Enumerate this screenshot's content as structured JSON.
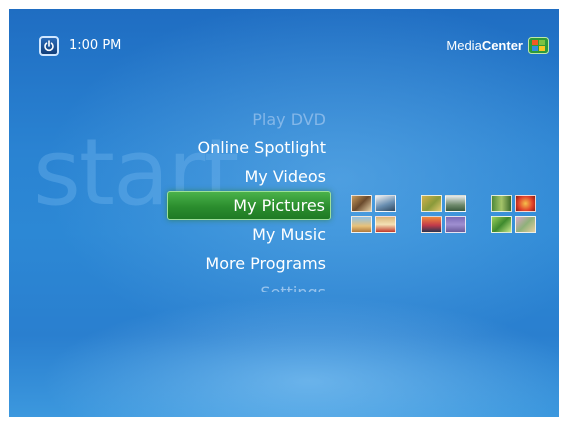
{
  "header": {
    "clock": "1:00 PM",
    "brand_light": "Media",
    "brand_bold": "Center"
  },
  "watermark": "start",
  "menu": {
    "items": [
      {
        "label": "Play DVD",
        "state": "faded-top"
      },
      {
        "label": "Online Spotlight",
        "state": "normal"
      },
      {
        "label": "My Videos",
        "state": "normal"
      },
      {
        "label": "My Pictures",
        "state": "selected"
      },
      {
        "label": "My Music",
        "state": "normal"
      },
      {
        "label": "More Programs",
        "state": "normal"
      },
      {
        "label": "Settings",
        "state": "faded-bottom"
      }
    ]
  },
  "colors": {
    "background": "#2a83d2",
    "selected": "#2b8d2e"
  },
  "icons": [
    "power-icon",
    "windows-logo-icon"
  ],
  "picture_thumbnails": [
    "photo",
    "photo",
    "photo",
    "photo",
    "photo",
    "photo",
    "photo",
    "photo",
    "photo",
    "photo",
    "photo",
    "photo"
  ]
}
